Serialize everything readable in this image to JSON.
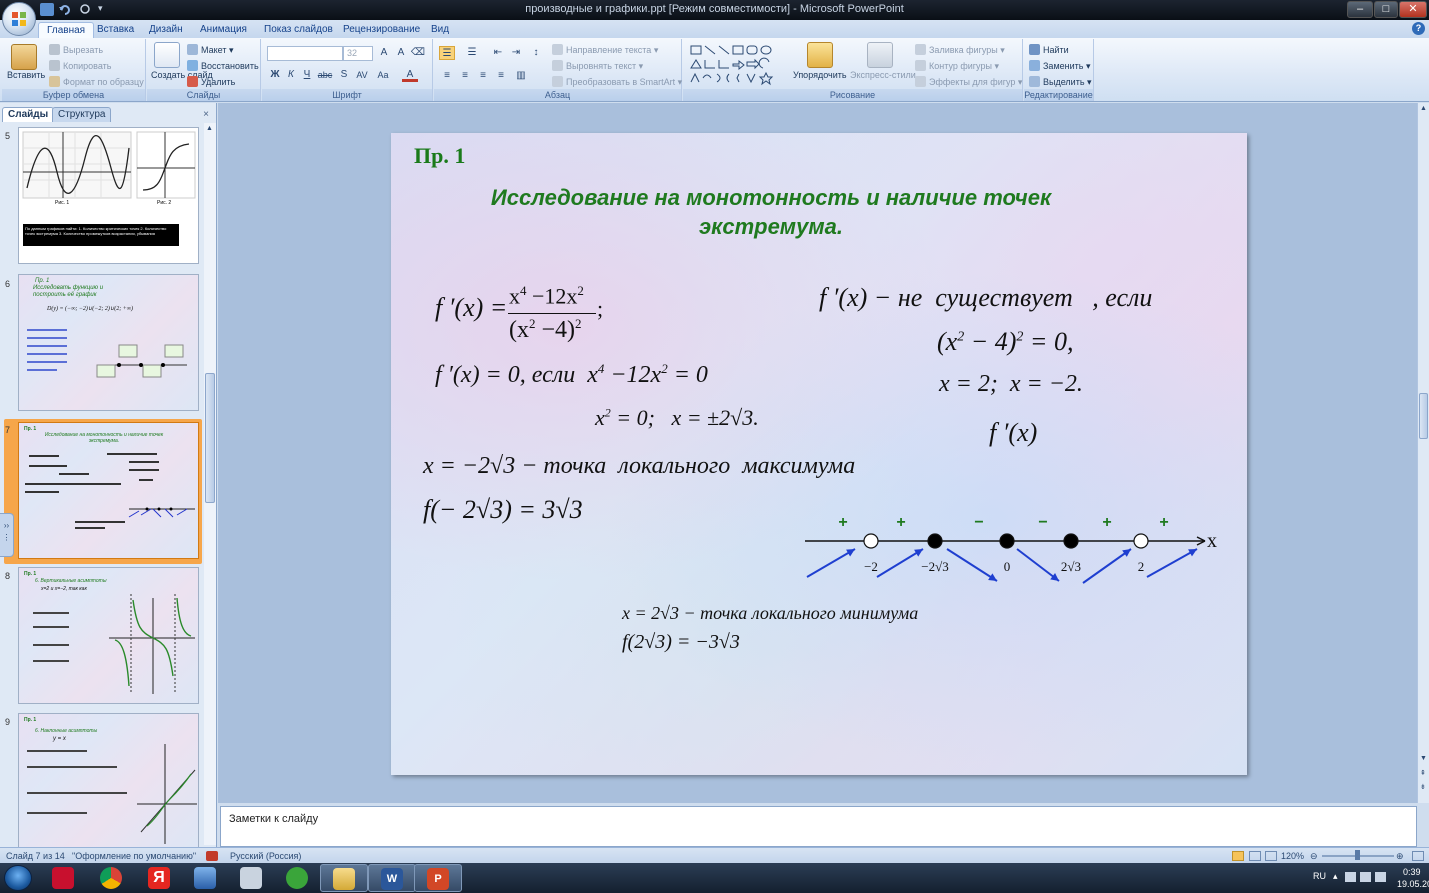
{
  "window": {
    "title": "производные и графики.ppt [Режим совместимости] - Microsoft PowerPoint"
  },
  "ribbon_tabs": [
    "Главная",
    "Вставка",
    "Дизайн",
    "Анимация",
    "Показ слайдов",
    "Рецензирование",
    "Вид"
  ],
  "ribbon": {
    "clipboard": {
      "paste": "Вставить",
      "cut": "Вырезать",
      "copy": "Копировать",
      "format_painter": "Формат по образцу",
      "label": "Буфер обмена"
    },
    "slides": {
      "new_slide": "Создать слайд",
      "layout": "Макет",
      "reset": "Восстановить",
      "delete": "Удалить",
      "label": "Слайды"
    },
    "font": {
      "size": "32",
      "label": "Шрифт"
    },
    "paragraph": {
      "text_direction": "Направление текста",
      "align_text": "Выровнять текст",
      "smartart": "Преобразовать в SmartArt",
      "label": "Абзац"
    },
    "drawing": {
      "arrange": "Упорядочить",
      "quick_styles": "Экспресс-стили",
      "shape_fill": "Заливка фигуры",
      "shape_outline": "Контур фигуры",
      "shape_effects": "Эффекты для фигур",
      "label": "Рисование"
    },
    "editing": {
      "find": "Найти",
      "replace": "Заменить",
      "select": "Выделить",
      "label": "Редактирование"
    }
  },
  "left_pane": {
    "tabs": [
      "Слайды",
      "Структура"
    ],
    "thumbnails": [
      {
        "number": "5",
        "fig1": "Рис. 1",
        "fig2": "Рис. 2",
        "caption": "По данным графиков найти: 1. Количество критических точек 2. Количество точек экстремума 3. Количество промежутков возрастания, убывания"
      },
      {
        "number": "6",
        "title": "Пр. 1",
        "heading": "Исследовать функцию и построить её график",
        "domain": "D(y) = (−∞; −2)∪(−2; 2)∪(2; +∞)"
      },
      {
        "number": "7",
        "title": "Пр. 1",
        "heading": "Исследование на монотонность и наличие точек экстремума."
      },
      {
        "number": "8",
        "title": "Пр. 1",
        "heading": "6. Вертикальные асимптоты",
        "sub": "x=2 и x=−2, так как"
      },
      {
        "number": "9",
        "title": "Пр. 1",
        "heading": "6. Наклонные асимптоты",
        "sub": "y = x"
      }
    ]
  },
  "slide": {
    "label": "Пр. 1",
    "heading": "Исследование на монотонность и наличие точек экстремума.",
    "sign_line": {
      "points": [
        {
          "label": "−2",
          "type": "open"
        },
        {
          "label": "−2√3",
          "type": "filled"
        },
        {
          "label": "0",
          "type": "filled"
        },
        {
          "label": "2√3",
          "type": "filled"
        },
        {
          "label": "2",
          "type": "open"
        }
      ],
      "signs": [
        "+",
        "+",
        "−",
        "−",
        "+",
        "+"
      ],
      "axis_label": "x"
    }
  },
  "notes": {
    "placeholder": "Заметки к слайду"
  },
  "status": {
    "slide": "Слайд 7 из 14",
    "theme": "\"Оформление по умолчанию\"",
    "lang": "Русский (Россия)",
    "zoom": "120%"
  },
  "tray": {
    "lang": "RU",
    "time": "0:39",
    "date": "19.05.2014"
  },
  "colors": {
    "accent_green": "#1f7a1f",
    "selected_thumb": "#f6a64a",
    "taskbar": "#14202f"
  }
}
